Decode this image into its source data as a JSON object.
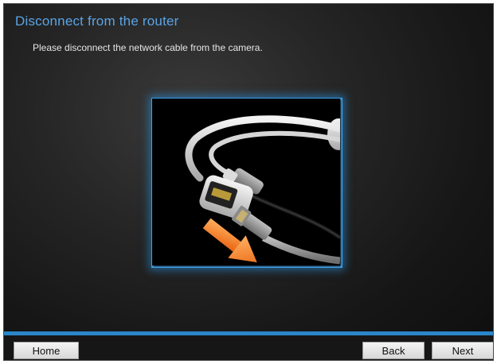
{
  "page": {
    "title": "Disconnect from the router",
    "instruction": "Please disconnect the network cable from the camera."
  },
  "buttons": {
    "home": "Home",
    "back": "Back",
    "next": "Next"
  },
  "colors": {
    "title": "#5aa4e6",
    "accent_bar": "#2b86c9",
    "frame_glow": "#3aa0e8",
    "arrow": "#f07a1a"
  }
}
